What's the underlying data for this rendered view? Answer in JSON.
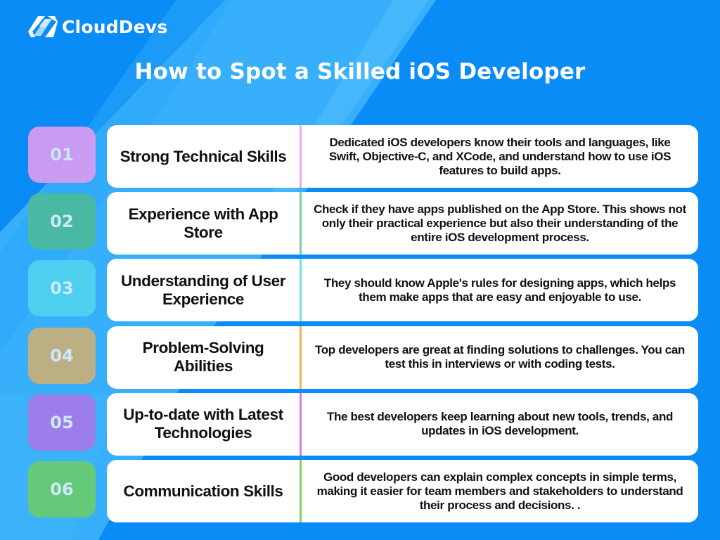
{
  "brand": {
    "name": "CloudDevs",
    "logo_icon": "clouddevs-logo-icon"
  },
  "title": "How to Spot a Skilled iOS Developer",
  "colors": {
    "background": "#0a8cf7",
    "brush_stroke": "#3db3fb",
    "card": "#ffffff",
    "text": "#111111",
    "badge_text": "#dbeefd"
  },
  "items": [
    {
      "number": "01",
      "title": "Strong Technical Skills",
      "description": "Dedicated iOS developers know their tools and languages, like Swift, Objective-C, and XCode, and understand how to use iOS features to build apps.",
      "badge_color": "#d99cf2",
      "accent_color": "#f5a3ee"
    },
    {
      "number": "02",
      "title": "Experience with App Store",
      "description": "Check if they have apps published on the App Store. This shows not only their practical experience but also their understanding of the entire iOS development process.",
      "badge_color": "#4dbb9c",
      "accent_color": "#6fd3a0"
    },
    {
      "number": "03",
      "title": "Understanding of User Experience",
      "description": "They should know Apple's rules for designing apps, which helps them make apps that are easy and enjoyable to use.",
      "badge_color": "#4fd3f0",
      "accent_color": "#6fe0e8"
    },
    {
      "number": "04",
      "title": "Problem-Solving Abilities",
      "description": "Top developers are great at finding solutions to challenges. You can test this in interviews or with coding tests.",
      "badge_color": "#c9b07a",
      "accent_color": "#f7b24d"
    },
    {
      "number": "05",
      "title": "Up-to-date with Latest Technologies",
      "description": "The best developers keep learning about new tools, trends, and updates in iOS development.",
      "badge_color": "#a57ae9",
      "accent_color": "#d27ce8"
    },
    {
      "number": "06",
      "title": "Communication Skills",
      "description": "Good developers can explain complex concepts in simple terms, making it easier for team members and stakeholders to understand their process and decisions. .",
      "badge_color": "#69cc6e",
      "accent_color": "#7fd35a"
    }
  ]
}
